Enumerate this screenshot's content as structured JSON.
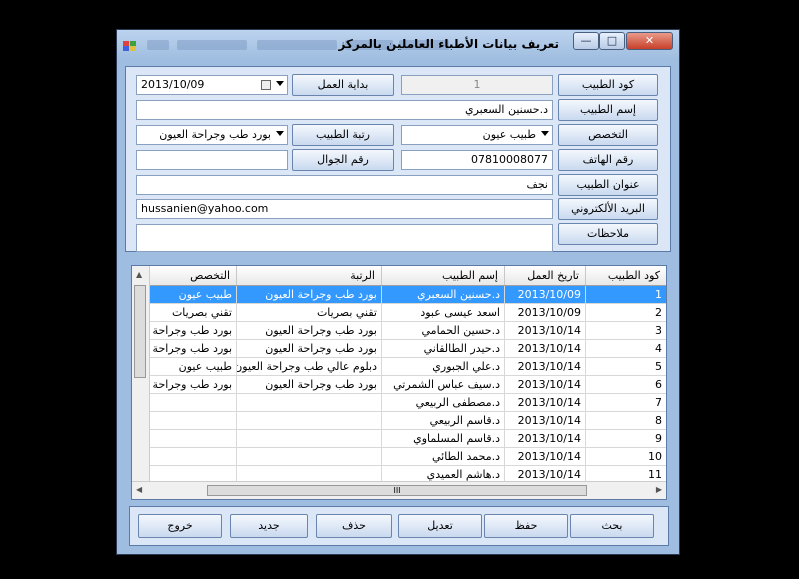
{
  "window": {
    "title": "تعريف بيانات الأطباء العاملين بالمركز",
    "min_glyph": "—",
    "max_glyph": "□",
    "close_glyph": "✕"
  },
  "form": {
    "code_label": "كود الطبيب",
    "code_value": "1",
    "start_label": "بداية العمل",
    "start_value": "2013/10/09",
    "name_label": "إسم الطبيب",
    "name_value": "د.حسنين السعبري",
    "spec_label": "التخصص",
    "spec_value": "طبيب عيون",
    "rank_label": "رتبة الطبيب",
    "rank_value": "بورد طب وجراحة العيون",
    "phone_label": "رقم الهاتف",
    "phone_value": "07810008077",
    "mobile_label": "رقم الجوال",
    "mobile_value": "",
    "address_label": "عنوان الطبيب",
    "address_value": "نجف",
    "email_label": "البريد الألكتروني",
    "email_value": "hussanien@yahoo.com",
    "notes_label": "ملاحظات",
    "notes_value": ""
  },
  "grid": {
    "columns": [
      "كود الطبيب",
      "تاريخ العمل",
      "إسم الطبيب",
      "الرتبة",
      "التخصص"
    ],
    "rows": [
      {
        "code": "1",
        "date": "2013/10/09",
        "name": "د.حسنين السعبري",
        "rank": "بورد طب وجراحة العيون",
        "spec": "طبيب عيون"
      },
      {
        "code": "2",
        "date": "2013/10/09",
        "name": "اسعد عيسى عبود",
        "rank": "تقني بصريات",
        "spec": "تقني بصريات"
      },
      {
        "code": "3",
        "date": "2013/10/14",
        "name": "د.حسين الحمامي",
        "rank": "بورد طب وجراحة العيون",
        "spec": "بورد طب وجراحة ال"
      },
      {
        "code": "4",
        "date": "2013/10/14",
        "name": "د.حيدر الطالقاني",
        "rank": "بورد طب وجراحة العيون",
        "spec": "بورد طب وجراحة ال"
      },
      {
        "code": "5",
        "date": "2013/10/14",
        "name": "د.علي الجبوري",
        "rank": "دبلوم عالي طب وجراحة العيون",
        "spec": "طبيب عيون"
      },
      {
        "code": "6",
        "date": "2013/10/14",
        "name": "د.سيف عباس الشمرتي",
        "rank": "بورد طب وجراحة العيون",
        "spec": "بورد طب وجراحة ال"
      },
      {
        "code": "7",
        "date": "2013/10/14",
        "name": "د.مصطفى الربيعي",
        "rank": "",
        "spec": ""
      },
      {
        "code": "8",
        "date": "2013/10/14",
        "name": "د.قاسم الربيعي",
        "rank": "",
        "spec": ""
      },
      {
        "code": "9",
        "date": "2013/10/14",
        "name": "د.قاسم المسلماوي",
        "rank": "",
        "spec": ""
      },
      {
        "code": "10",
        "date": "2013/10/14",
        "name": "د.محمد الطائي",
        "rank": "",
        "spec": ""
      },
      {
        "code": "11",
        "date": "2013/10/14",
        "name": "د.هاشم العميدي",
        "rank": "",
        "spec": ""
      }
    ],
    "hscroll_grip": "III",
    "selected_row": 0
  },
  "buttons": {
    "search": "بحث",
    "save": "حفظ",
    "edit": "تعديل",
    "delete": "حذف",
    "new": "جديد",
    "exit": "خروج"
  }
}
